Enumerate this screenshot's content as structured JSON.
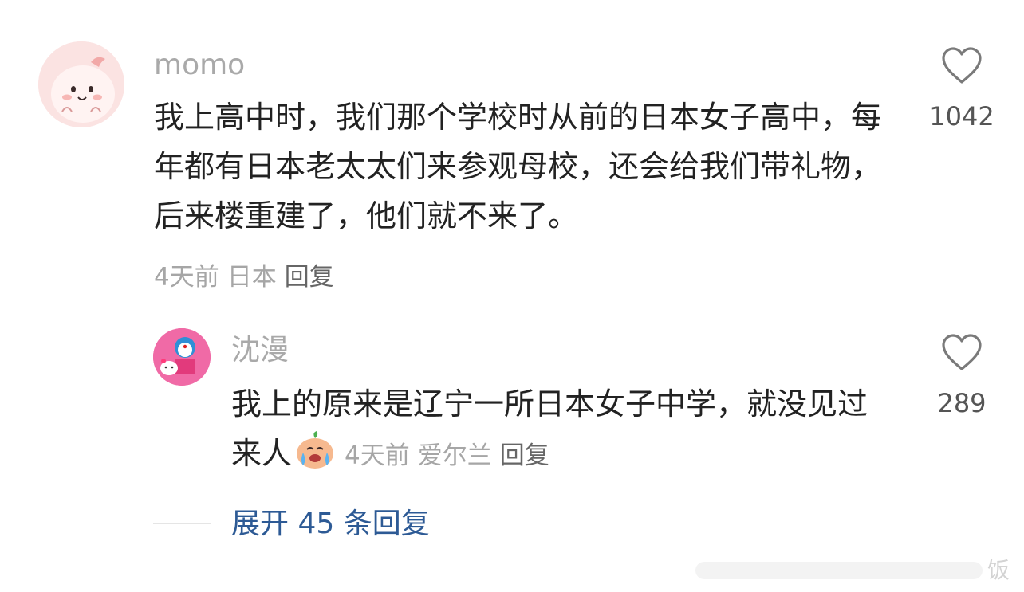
{
  "comment": {
    "username": "momo",
    "text": "我上高中时，我们那个学校时从前的日本女子高中，每年都有日本老太太们来参观母校，还会给我们带礼物，后来楼重建了，他们就不来了。",
    "time": "4天前",
    "location": "日本",
    "reply_label": "回复",
    "like_count": "1042",
    "avatar_icon": "pink-peach-character-avatar"
  },
  "reply": {
    "username": "沈漫",
    "text": "我上的原来是辽宁一所日本女子中学，就没见过来人",
    "emoji": "crying-peach-emoji",
    "time": "4天前",
    "location": "爱尔兰",
    "reply_label": "回复",
    "like_count": "289",
    "avatar_icon": "doraemon-hello-kitty-avatar"
  },
  "expand": {
    "label": "展开 45 条回复"
  },
  "watermark": {
    "text": "饭"
  },
  "colors": {
    "username": "#a9a9a9",
    "body": "#222222",
    "meta": "#a6a6a6",
    "link": "#2d5a95"
  }
}
